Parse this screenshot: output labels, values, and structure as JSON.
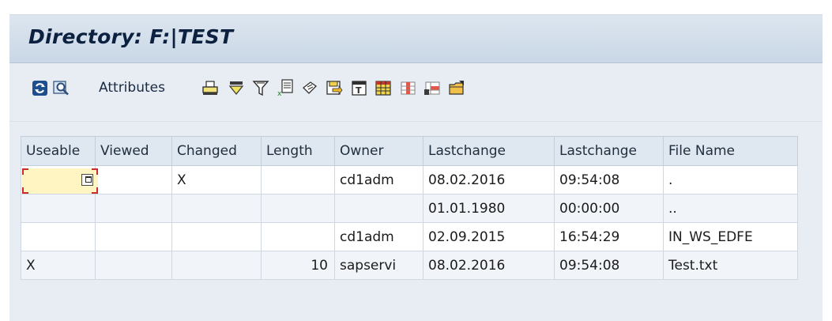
{
  "window": {
    "title": "Directory: F:|TEST"
  },
  "toolbar": {
    "attributes_label": "Attributes",
    "icons": [
      "refresh-icon",
      "display-icon",
      "print-icon",
      "sort-icon",
      "filter-icon",
      "export-icon",
      "mail-icon",
      "save-icon",
      "totals-icon",
      "layout-icon",
      "select-layout-icon",
      "change-layout-icon",
      "open-folder-icon"
    ]
  },
  "table": {
    "headers": [
      "Useable",
      "Viewed",
      "Changed",
      "Length",
      "Owner",
      "Lastchange",
      "Lastchange",
      "File Name"
    ],
    "rows": [
      [
        "",
        "",
        "X",
        "",
        "cd1adm",
        "08.02.2016",
        "09:54:08",
        "."
      ],
      [
        "",
        "",
        "",
        "",
        "",
        "01.01.1980",
        "00:00:00",
        ".."
      ],
      [
        "",
        "",
        "",
        "",
        "cd1adm",
        "02.09.2015",
        "16:54:29",
        "IN_WS_EDFE"
      ],
      [
        "X",
        "",
        "",
        "10",
        "sapservi",
        "08.02.2016",
        "09:54:08",
        "Test.txt"
      ]
    ]
  },
  "colors": {
    "title_bar": "#c9d7e6",
    "header_bg": "#dfe7f0",
    "focus_cell": "#fff5c2",
    "focus_corner": "#cc2b2b"
  }
}
